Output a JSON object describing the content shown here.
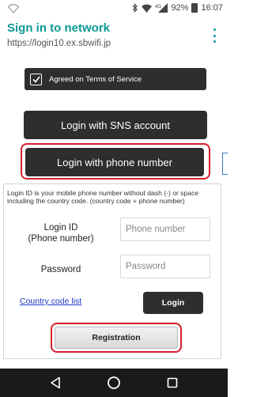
{
  "status_bar": {
    "battery_percent": "92%",
    "time": "16:07",
    "network_type": "4G",
    "icons": [
      "wifi-icon",
      "bluetooth-icon",
      "signal-icon",
      "battery-icon"
    ]
  },
  "header": {
    "title": "Sign in to network",
    "url": "https://login10.ex.sbwifi.jp",
    "menu_icon": "more-vert-icon"
  },
  "terms": {
    "label": "Agreed on Terms of Service",
    "checked": true
  },
  "buttons": {
    "sns_login": "Login with SNS account",
    "phone_login": "Login with phone number"
  },
  "login_form": {
    "note": "Login ID is your mobile phone number without dash (-) or space including the country code. (country code + phone number)",
    "login_id_label_line1": "Login ID",
    "login_id_label_line2": "(Phone number)",
    "login_id_placeholder": "Phone number",
    "password_label": "Password",
    "password_placeholder": "Password",
    "country_code_link": "Country code list",
    "login_button": "Login",
    "registration_button": "Registration"
  },
  "colors": {
    "accent": "#0b9a93",
    "highlight": "#d81e2a",
    "button_dark": "#2e2e2e",
    "link": "#1a37c6"
  },
  "nav_bar": {
    "icons": [
      "back-icon",
      "home-icon",
      "recent-apps-icon"
    ]
  }
}
